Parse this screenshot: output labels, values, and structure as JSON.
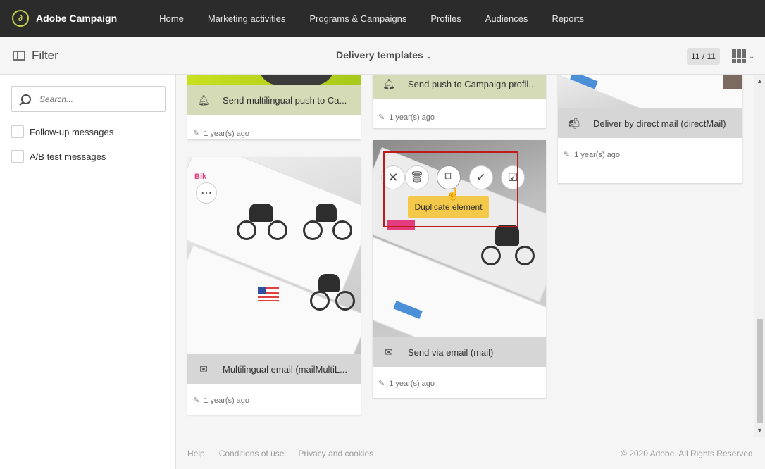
{
  "app": {
    "name": "Adobe Campaign"
  },
  "nav": {
    "items": [
      "Home",
      "Marketing activities",
      "Programs & Campaigns",
      "Profiles",
      "Audiences",
      "Reports"
    ]
  },
  "subheader": {
    "filter_label": "Filter",
    "view_title": "Delivery templates",
    "counter": "11 / 11"
  },
  "filters": {
    "search_placeholder": "Search...",
    "options": [
      "Follow-up messages",
      "A/B test messages"
    ]
  },
  "cards": [
    {
      "title": "Send multilingual push to Ca...",
      "icon": "bell-icon",
      "meta": "1 year(s) ago"
    },
    {
      "title": "Send push to Campaign profil...",
      "icon": "bell-icon",
      "meta": "1 year(s) ago"
    },
    {
      "title": "Deliver by direct mail (directMail)",
      "icon": "mailbox-icon",
      "meta": "1 year(s) ago"
    },
    {
      "title": "Multilingual email (mailMultiL...",
      "icon": "envelope-icon",
      "meta": "1 year(s) ago"
    },
    {
      "title": "Send via email (mail)",
      "icon": "envelope-icon",
      "meta": "1 year(s) ago"
    }
  ],
  "card_actions": {
    "tooltip": "Duplicate element"
  },
  "footer": {
    "links": [
      "Help",
      "Conditions of use",
      "Privacy and cookies"
    ],
    "copyright": "© 2020 Adobe. All Rights Reserved."
  },
  "colors": {
    "topbar": "#2b2b2b",
    "accent_green": "#c8d24a",
    "tooltip": "#f4c94a",
    "highlight": "#c2191b"
  }
}
